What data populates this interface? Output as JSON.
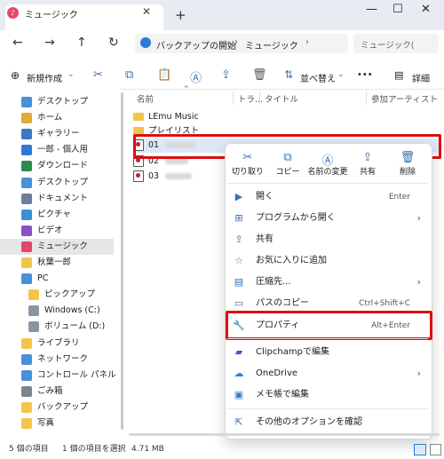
{
  "window": {
    "tab_title": "ミュージック",
    "tab_icon": "music-icon",
    "new_tab": "+",
    "min": "—",
    "max": "☐",
    "close": "✕"
  },
  "nav": {
    "back": "←",
    "forward": "→",
    "up": "↑",
    "refresh": "↻",
    "breadcrumb": [
      "バックアップの開始",
      "ミュージック"
    ],
    "search_placeholder": "ミュージック("
  },
  "toolbar": {
    "new_label": "新規作成",
    "sort_label": "並べ替え",
    "more": "•••",
    "details_label": "詳細"
  },
  "sidebar": {
    "items": [
      {
        "label": "デスクトップ",
        "icon": "desktop-icon",
        "color": "#4a90d9",
        "indent": 0
      },
      {
        "label": "ホーム",
        "icon": "home-icon",
        "color": "#e2a93b",
        "indent": 0
      },
      {
        "label": "ギャラリー",
        "icon": "gallery-icon",
        "color": "#3a78c9",
        "indent": 0
      },
      {
        "label": "一郎 - 個人用",
        "icon": "onedrive-icon",
        "color": "#2f7ad6",
        "indent": 0
      },
      {
        "label": "ダウンロード",
        "icon": "download-icon",
        "color": "#2d8a4e",
        "indent": 0
      },
      {
        "label": "デスクトップ",
        "icon": "desktop-icon",
        "color": "#4a90d9",
        "indent": 0
      },
      {
        "label": "ドキュメント",
        "icon": "documents-icon",
        "color": "#6b7f99",
        "indent": 0
      },
      {
        "label": "ピクチャ",
        "icon": "pictures-icon",
        "color": "#3a8ed9",
        "indent": 0
      },
      {
        "label": "ビデオ",
        "icon": "video-icon",
        "color": "#8a4fc9",
        "indent": 0
      },
      {
        "label": "ミュージック",
        "icon": "music-icon",
        "color": "#e8456b",
        "indent": 0,
        "selected": true
      },
      {
        "label": "秋葉一郎",
        "icon": "folder-icon",
        "color": "#f3c44c",
        "indent": 0
      },
      {
        "label": "PC",
        "icon": "pc-icon",
        "color": "#4a90d9",
        "indent": 0
      },
      {
        "label": "ピックアップ",
        "icon": "folder-icon",
        "color": "#f3c44c",
        "indent": 1
      },
      {
        "label": "Windows (C:)",
        "icon": "drive-icon",
        "color": "#8a95a3",
        "indent": 1
      },
      {
        "label": "ボリューム (D:)",
        "icon": "drive-icon",
        "color": "#8a95a3",
        "indent": 1
      },
      {
        "label": "ライブラリ",
        "icon": "folder-icon",
        "color": "#f3c44c",
        "indent": 0
      },
      {
        "label": "ネットワーク",
        "icon": "network-icon",
        "color": "#4a90d9",
        "indent": 0
      },
      {
        "label": "コントロール パネル",
        "icon": "control-panel-icon",
        "color": "#4a90d9",
        "indent": 0
      },
      {
        "label": "ごみ箱",
        "icon": "recycle-bin-icon",
        "color": "#7a8592",
        "indent": 0
      },
      {
        "label": "バックアップ",
        "icon": "folder-icon",
        "color": "#f3c44c",
        "indent": 0
      },
      {
        "label": "写真",
        "icon": "folder-icon",
        "color": "#f3c44c",
        "indent": 0
      }
    ]
  },
  "columns": {
    "name": "名前",
    "track": "トラ...",
    "title": "タイトル",
    "artist": "参加アーティスト"
  },
  "files": [
    {
      "label": "LEmu Music",
      "kind": "folder"
    },
    {
      "label": "プレイリスト",
      "kind": "folder"
    },
    {
      "label": "01",
      "kind": "music"
    },
    {
      "label": "02",
      "kind": "music"
    },
    {
      "label": "03",
      "kind": "music"
    }
  ],
  "context_menu": {
    "quick_actions": [
      {
        "label": "切り取り",
        "icon": "cut-icon",
        "glyph": "✂"
      },
      {
        "label": "コピー",
        "icon": "copy-icon",
        "glyph": "⧉"
      },
      {
        "label": "名前の変更",
        "icon": "rename-icon",
        "glyph": "Ⓐ"
      },
      {
        "label": "共有",
        "icon": "share-icon",
        "glyph": "⇪"
      },
      {
        "label": "削除",
        "icon": "delete-icon",
        "glyph": "🗑"
      }
    ],
    "items": [
      {
        "label": "開く",
        "icon": "open-icon",
        "glyph": "▶",
        "shortcut": "Enter"
      },
      {
        "label": "プログラムから開く",
        "icon": "open-with-icon",
        "glyph": "⊞",
        "arrow": "›"
      },
      {
        "label": "共有",
        "icon": "share-icon",
        "glyph": "⇪"
      },
      {
        "label": "お気に入りに追加",
        "icon": "star-icon",
        "glyph": "☆"
      },
      {
        "label": "圧縮先...",
        "icon": "zip-icon",
        "glyph": "▤",
        "arrow": "›"
      },
      {
        "label": "パスのコピー",
        "icon": "copy-path-icon",
        "glyph": "▭",
        "shortcut": "Ctrl+Shift+C"
      },
      {
        "label": "プロパティ",
        "icon": "wrench-icon",
        "glyph": "🔧",
        "shortcut": "Alt+Enter"
      },
      {
        "label": "Clipchampで編集",
        "icon": "clipchamp-icon",
        "glyph": "▰"
      },
      {
        "label": "OneDrive",
        "icon": "onedrive-icon",
        "glyph": "☁",
        "arrow": "›"
      },
      {
        "label": "メモ帳で編集",
        "icon": "notepad-icon",
        "glyph": "▣"
      },
      {
        "label": "その他のオプションを確認",
        "icon": "more-options-icon",
        "glyph": "⇱"
      }
    ]
  },
  "status": {
    "count": "5 個の項目",
    "selected": "1 個の項目を選択",
    "size": "4.71 MB"
  }
}
